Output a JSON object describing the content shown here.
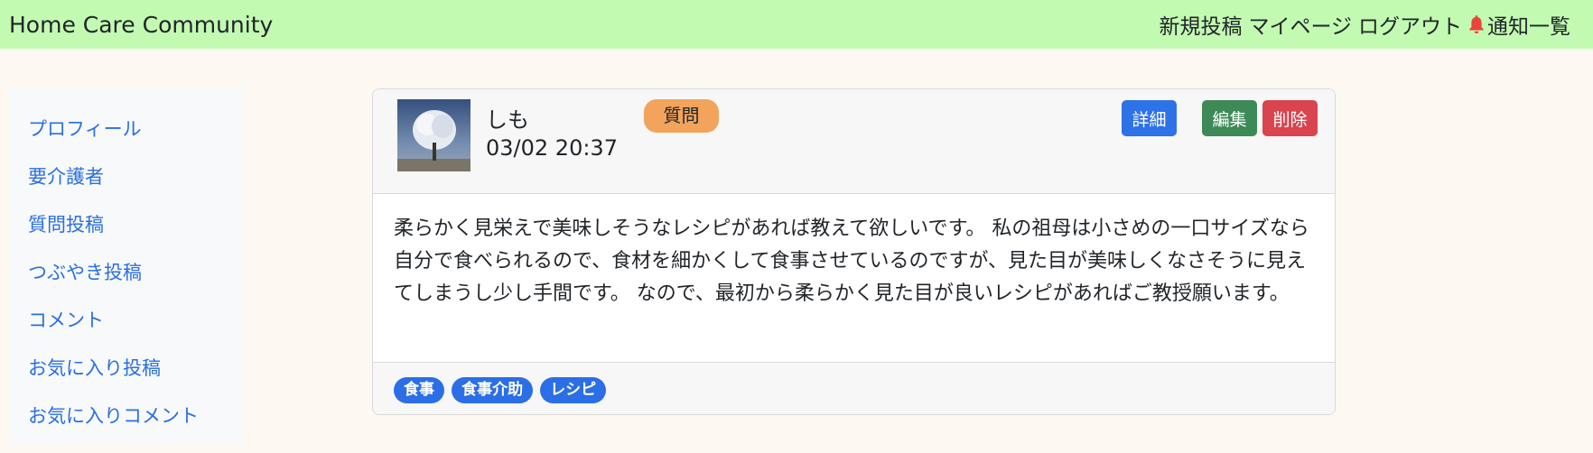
{
  "navbar": {
    "brand": "Home Care Community",
    "links": [
      "新規投稿",
      "マイページ",
      "ログアウト"
    ],
    "notifications_label": "通知一覧",
    "bell_icon": "bell-icon",
    "bell_color": "#e8453c"
  },
  "sidebar": {
    "items": [
      "プロフィール",
      "要介護者",
      "質問投稿",
      "つぶやき投稿",
      "コメント",
      "お気に入り投稿",
      "お気に入りコメント"
    ]
  },
  "post": {
    "avatar_icon": "tree-avatar-image",
    "user_name": "しも",
    "date": "03/02 20:37",
    "type_badge": "質問",
    "buttons": {
      "detail": "詳細",
      "edit": "編集",
      "delete": "削除"
    },
    "body": "柔らかく見栄えで美味しそうなレシピがあれば教えて欲しいです。 私の祖母は小さめの一口サイズなら自分で食べられるので、食材を細かくして食事させているのですが、見た目が美味しくなさそうに見えてしまうし少し手間です。 なので、最初から柔らかく見た目が良いレシピがあればご教授願います。",
    "tags": [
      "食事",
      "食事介助",
      "レシピ"
    ]
  },
  "colors": {
    "navbar_bg": "#c2fab2",
    "link": "#2a6fe0",
    "badge": "#f2a35c",
    "detail_button": "#2e72e8",
    "edit_button": "#3d8a57",
    "delete_button": "#d9444f",
    "tag": "#2b6ee6"
  }
}
